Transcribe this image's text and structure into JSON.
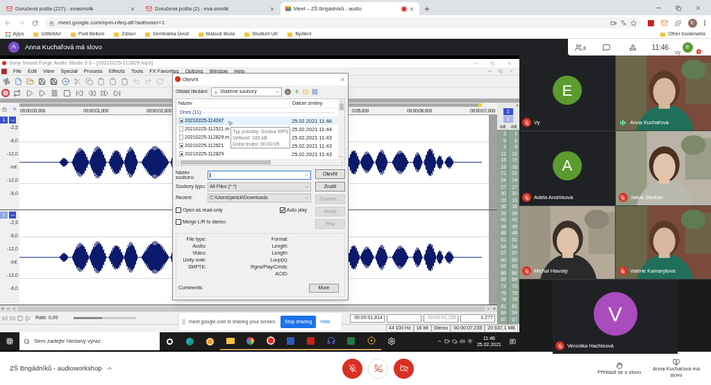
{
  "browser": {
    "tabs": [
      {
        "title": "Doručená pošta (227) - evasmolik",
        "selected": false
      },
      {
        "title": "Doručená pošta (2) - eva.smolik",
        "selected": false
      },
      {
        "title": "Meet – ZŠ Brigádníků - audio",
        "selected": true
      }
    ],
    "address": "meet.google.com/npm-nfeq-afi?authuser=1",
    "profile_initial": "E",
    "bookmarks": [
      "Apps",
      "Učitelství",
      "Post Bellum",
      "Zdraví",
      "Seminárka Úvod",
      "Matouš škola",
      "Studium UK",
      "Bydlení"
    ],
    "other_bookmarks": "Other bookmarks"
  },
  "meet_header": {
    "speaker_initial": "A",
    "speaker_text": "Anna Kuchařová má slovo",
    "people_count": "8",
    "clock": "11:46",
    "self_label": "Vy",
    "self_initial": "E"
  },
  "sound_forge": {
    "title": "Sony Sound Forge Audio Studio 9.0 - [20210225-112829.mp3]",
    "menu": [
      "File",
      "Edit",
      "View",
      "Special",
      "Process",
      "Effects",
      "Tools",
      "FX Favorites",
      "Options",
      "Window",
      "Help"
    ],
    "ruler": [
      "00:00:00,000",
      "00:00:01,000",
      "00:00:02,000",
      "0:05,000",
      "00:00:06,000",
      "00:00:07,000"
    ],
    "channels": [
      {
        "number": "1",
        "selected": true,
        "scale": [
          "-2,5",
          "-6,0",
          "-12,0",
          "-Inf.",
          "-12,0",
          "-6,0"
        ]
      },
      {
        "number": "2",
        "selected": false,
        "scale": [
          "-2,5",
          "-6,0",
          "-12,0",
          "-Inf.",
          "-12,0",
          "-6,0"
        ]
      }
    ],
    "meter": [
      {
        "label": "1",
        "selected": true,
        "peak": "-Inf.",
        "scale": [
          "3",
          "6",
          "9",
          "12",
          "15",
          "18",
          "21",
          "24",
          "27",
          "30",
          "33",
          "36",
          "39",
          "42",
          "45",
          "48",
          "51",
          "54",
          "57",
          "60",
          "63",
          "66",
          "69",
          "72",
          "75",
          "78",
          "81",
          "84",
          "87"
        ]
      },
      {
        "label": "2",
        "selected": false,
        "peak": "-Inf.",
        "scale": [
          "3",
          "6",
          "9",
          "12",
          "15",
          "18",
          "21",
          "24",
          "27",
          "30",
          "33",
          "36",
          "39",
          "42",
          "45",
          "48",
          "51",
          "54",
          "57",
          "60",
          "63",
          "66",
          "69",
          "72",
          "75",
          "78",
          "81",
          "84",
          "87"
        ]
      }
    ],
    "rate": "Rate: 0,00",
    "rate_slider": {
      "level": 0.45
    },
    "positions": [
      {
        "text": "00:00:01,814",
        "disabled": false
      },
      {
        "text": "00:00:02,355",
        "disabled": true
      },
      {
        "text": "1:277",
        "disabled": false
      }
    ],
    "status": [
      "44 100 Hz",
      "16 bit",
      "Stereo",
      "00:00:07,235",
      "20 637,1 MB"
    ]
  },
  "open_dialog": {
    "title": "Otevřít",
    "look_in_label": "Oblast hledání:",
    "look_in": "Stažené soubory",
    "columns": [
      "Název",
      "Datum změny"
    ],
    "group": "Dnes (11)",
    "files": [
      {
        "name": "20210225-114247",
        "date": "25.02.2021 11:46",
        "kind": "audio",
        "selected": true
      },
      {
        "name": "20210225-112521.m",
        "date": "25.02.2021 11:44",
        "kind": "file",
        "selected": false
      },
      {
        "name": "20210225-112829.m",
        "date": "25.02.2021 11:43",
        "kind": "file",
        "selected": false
      },
      {
        "name": "20210225-112521",
        "date": "25.02.2021 11:43",
        "kind": "audio",
        "selected": false
      },
      {
        "name": "20210225-112829",
        "date": "25.02.2021 11:43",
        "kind": "audio",
        "selected": false
      }
    ],
    "tooltip": [
      "Typ položky: Soubor MP3",
      "Velikost: 183 kB",
      "Doba trvání: 00:00:05"
    ],
    "filename_label": "Název souboru:",
    "filetype_label": "Soubory typu:",
    "filetype": "All Files (*.*)",
    "recent_label": "Recent:",
    "recent": "C:\\Users\\janick\\Downloads",
    "checkboxes": [
      {
        "label": "Open as read-only",
        "checked": false
      },
      {
        "label": "Auto play",
        "checked": true
      },
      {
        "label": "Merge L/R to stereo",
        "checked": false
      }
    ],
    "buttons": [
      {
        "label": "Otevřít",
        "disabled": false
      },
      {
        "label": "Zrušit",
        "disabled": false
      },
      {
        "label": "Custom...",
        "disabled": true
      },
      {
        "label": "About",
        "disabled": true
      },
      {
        "label": "Play",
        "disabled": true
      }
    ],
    "info_left": [
      "File type:",
      "Audio:",
      "Video:",
      "Unity note:",
      "SMPTE:"
    ],
    "info_right": [
      "Format:",
      "Length:",
      "Length:",
      "Loop(s):",
      "Rgns/Play/Cmds:",
      "ACID:"
    ],
    "comments_label": "Comments:",
    "more": "More"
  },
  "sharing_bar": {
    "text": "meet.google.com is sharing your screen.",
    "stop": "Stop sharing",
    "hide": "Hide"
  },
  "taskbar": {
    "search_placeholder": "Sem zadejte hledaný výraz",
    "time": "11:46",
    "date": "25.02.2021"
  },
  "participants": [
    {
      "name": "Vy",
      "kind": "avatar",
      "initial": "E",
      "color": "#5b9b2f",
      "muted": true
    },
    {
      "name": "Anna Kuchařová",
      "kind": "video",
      "muted": false
    },
    {
      "name": "Adéla Andrlíková",
      "kind": "avatar",
      "initial": "A",
      "color": "#5b9b2f",
      "muted": true
    },
    {
      "name": "Jakub Skokan",
      "kind": "video",
      "muted": true
    },
    {
      "name": "Michal Hlavatý",
      "kind": "video",
      "muted": true
    },
    {
      "name": "Valérie Kamarytová",
      "kind": "video",
      "muted": true
    },
    {
      "name": "Veronika Hachleová",
      "kind": "avatar",
      "initial": "V",
      "color": "#a94cbd",
      "muted": true
    }
  ],
  "meet_bottom": {
    "meeting_name": "ZŠ Brigádníků - audioworkshop",
    "mic_off": true,
    "camera_off": true,
    "raise_hand": "Přihlásit se o slovo",
    "presenter": "Anna Kuchařová má slovo"
  }
}
